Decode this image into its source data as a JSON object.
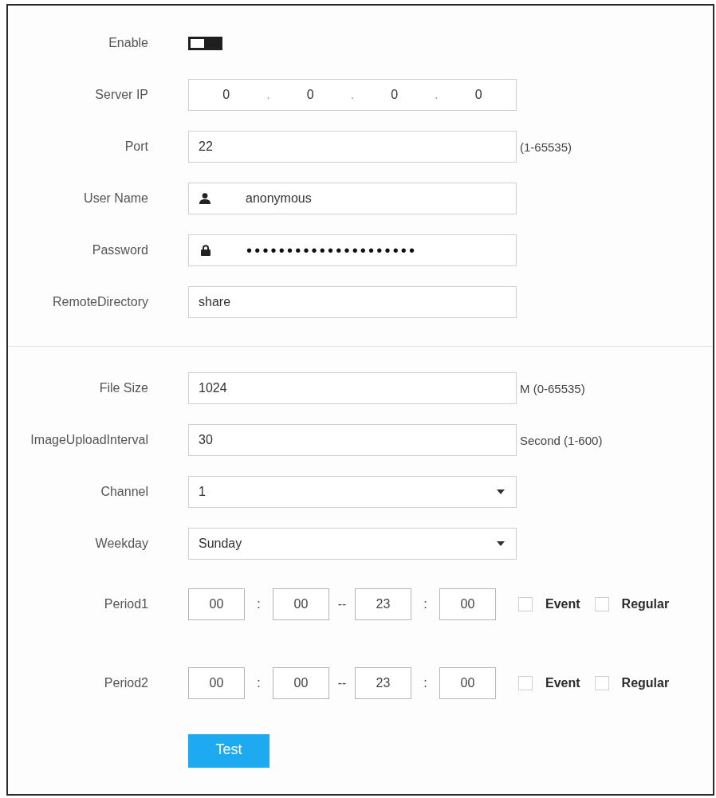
{
  "sections": [
    {
      "fields": [
        {
          "kind": "toggle",
          "label": "Enable",
          "on": false
        },
        {
          "kind": "ip",
          "label": "Server IP",
          "octets": [
            "0",
            "0",
            "0",
            "0"
          ],
          "separators": [
            ".",
            ".",
            "."
          ]
        },
        {
          "kind": "text",
          "label": "Port",
          "value": "22",
          "hint": "(1-65535)"
        },
        {
          "kind": "username",
          "label": "User Name",
          "value": "anonymous"
        },
        {
          "kind": "password",
          "label": "Password",
          "value": "•••••••••••••••••••••"
        },
        {
          "kind": "text",
          "label": "RemoteDirectory",
          "value": "share"
        }
      ]
    },
    {
      "fields": [
        {
          "kind": "text",
          "label": "File Size",
          "value": "1024",
          "hint": "M (0-65535)"
        },
        {
          "kind": "text",
          "label": "ImageUploadInterval",
          "value": "30",
          "hint": "Second (1-600)"
        },
        {
          "kind": "select",
          "label": "Channel",
          "value": "1"
        },
        {
          "kind": "select",
          "label": "Weekday",
          "value": "Sunday"
        },
        {
          "kind": "period",
          "label": "Period1",
          "start_hour": "00",
          "start_minute": "00",
          "end_hour": "23",
          "end_minute": "00",
          "time_separators": [
            ":",
            ":"
          ],
          "range_separator": "--",
          "options": [
            {
              "label": "Event",
              "checked": false
            },
            {
              "label": "Regular",
              "checked": false
            }
          ]
        },
        {
          "kind": "period",
          "label": "Period2",
          "start_hour": "00",
          "start_minute": "00",
          "end_hour": "23",
          "end_minute": "00",
          "time_separators": [
            ":",
            ":"
          ],
          "range_separator": "--",
          "options": [
            {
              "label": "Event",
              "checked": false
            },
            {
              "label": "Regular",
              "checked": false
            }
          ]
        }
      ]
    }
  ],
  "test_button": {
    "label": "Test"
  }
}
